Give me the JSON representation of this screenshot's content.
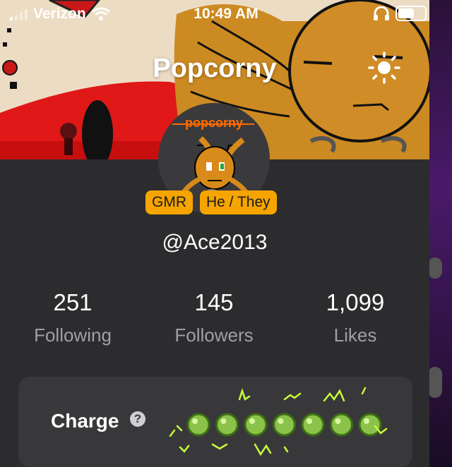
{
  "status_bar": {
    "carrier": "Verizon",
    "time": "10:49 AM"
  },
  "profile": {
    "title": "Popcorny",
    "avatar_text": "popcorny",
    "badges": [
      "GMR",
      "He / They"
    ],
    "handle": "@Ace2013"
  },
  "stats": [
    {
      "value": "251",
      "label": "Following"
    },
    {
      "value": "145",
      "label": "Followers"
    },
    {
      "value": "1,099",
      "label": "Likes"
    }
  ],
  "charge": {
    "label": "Charge",
    "help_glyph": "?",
    "orb_count": 7
  },
  "icons": {
    "signal": "signal-icon",
    "wifi": "wifi-icon",
    "headphones": "headphones-icon",
    "battery": "battery-icon",
    "brightness": "sun-icon",
    "help": "question-circle-icon"
  },
  "colors": {
    "panel_bg": "#2c2c2e",
    "card_bg": "#38383a",
    "badge_bg": "#f5a400",
    "stat_label": "#a0a0a4",
    "orb_green": "#8bc34a",
    "lightning": "#c6ff3a"
  }
}
